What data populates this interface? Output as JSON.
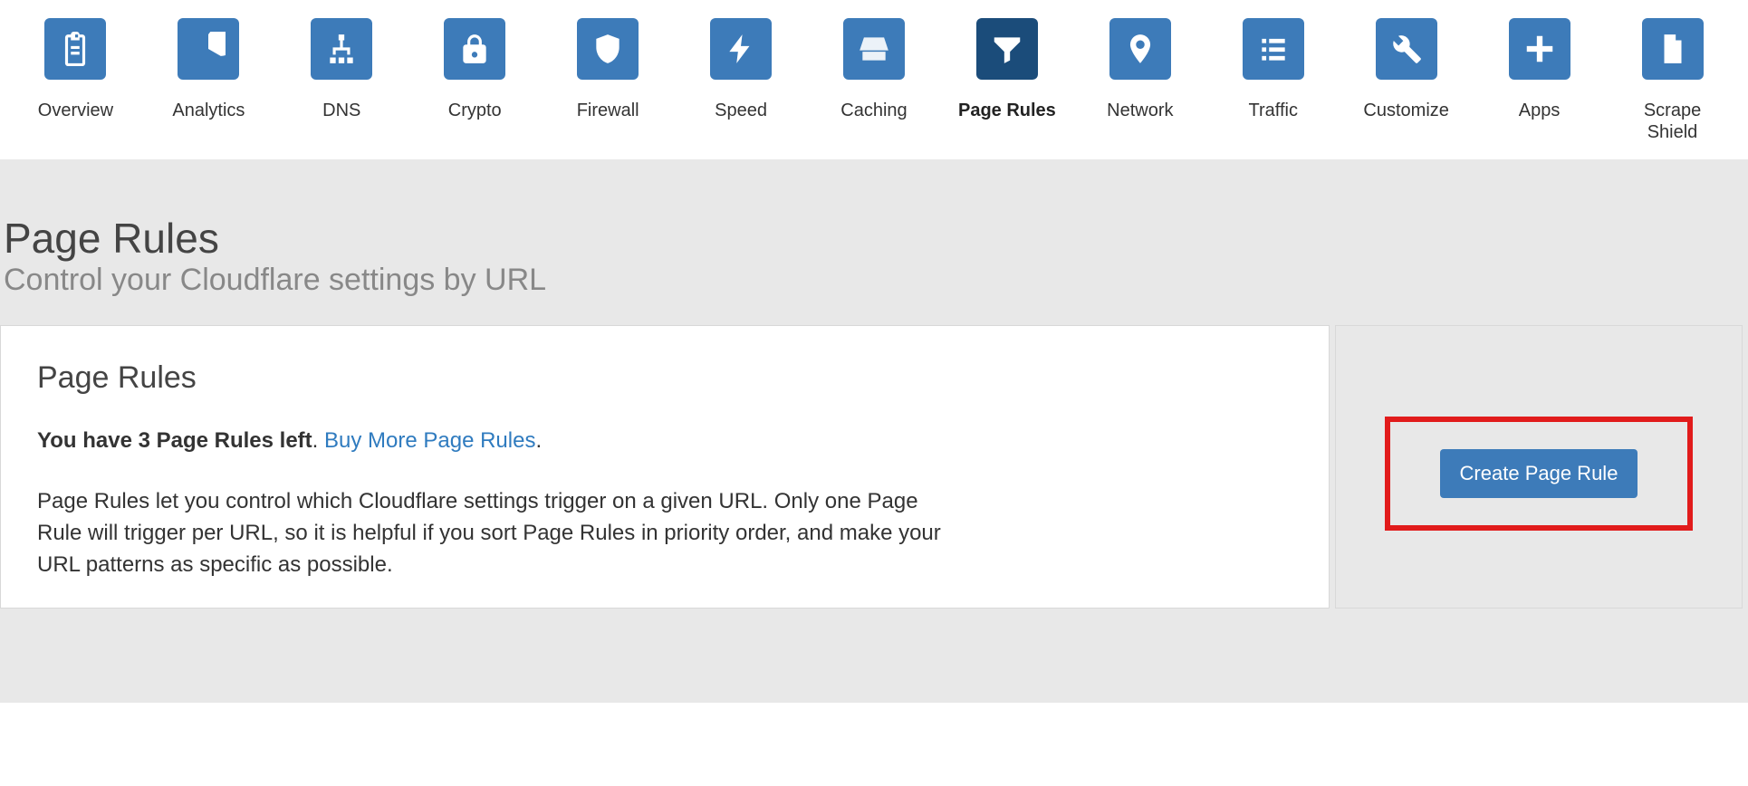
{
  "nav": {
    "items": [
      {
        "label": "Overview",
        "icon": "clipboard-icon",
        "active": false
      },
      {
        "label": "Analytics",
        "icon": "pie-chart-icon",
        "active": false
      },
      {
        "label": "DNS",
        "icon": "sitemap-icon",
        "active": false
      },
      {
        "label": "Crypto",
        "icon": "lock-icon",
        "active": false
      },
      {
        "label": "Firewall",
        "icon": "shield-icon",
        "active": false
      },
      {
        "label": "Speed",
        "icon": "bolt-icon",
        "active": false
      },
      {
        "label": "Caching",
        "icon": "drive-icon",
        "active": false
      },
      {
        "label": "Page Rules",
        "icon": "funnel-icon",
        "active": true
      },
      {
        "label": "Network",
        "icon": "pin-icon",
        "active": false
      },
      {
        "label": "Traffic",
        "icon": "list-icon",
        "active": false
      },
      {
        "label": "Customize",
        "icon": "wrench-icon",
        "active": false
      },
      {
        "label": "Apps",
        "icon": "plus-icon",
        "active": false
      },
      {
        "label": "Scrape Shield",
        "icon": "document-icon",
        "active": false
      }
    ]
  },
  "header": {
    "title": "Page Rules",
    "subtitle": "Control your Cloudflare settings by URL"
  },
  "main_card": {
    "title": "Page Rules",
    "rules_left_bold": "You have 3 Page Rules left",
    "rules_left_period": ". ",
    "buy_more_link": "Buy More Page Rules",
    "trailing_period": ".",
    "description": "Page Rules let you control which Cloudflare settings trigger on a given URL. Only one Page Rule will trigger per URL, so it is helpful if you sort Page Rules in priority order, and make your URL patterns as specific as possible."
  },
  "side_card": {
    "create_button_label": "Create Page Rule"
  },
  "colors": {
    "nav_tile": "#3d7bb9",
    "nav_tile_active": "#1b4c7a",
    "link": "#2f7bbf",
    "button": "#3d7bb9",
    "highlight_border": "#e11b1b",
    "content_bg": "#e8e8e8"
  }
}
